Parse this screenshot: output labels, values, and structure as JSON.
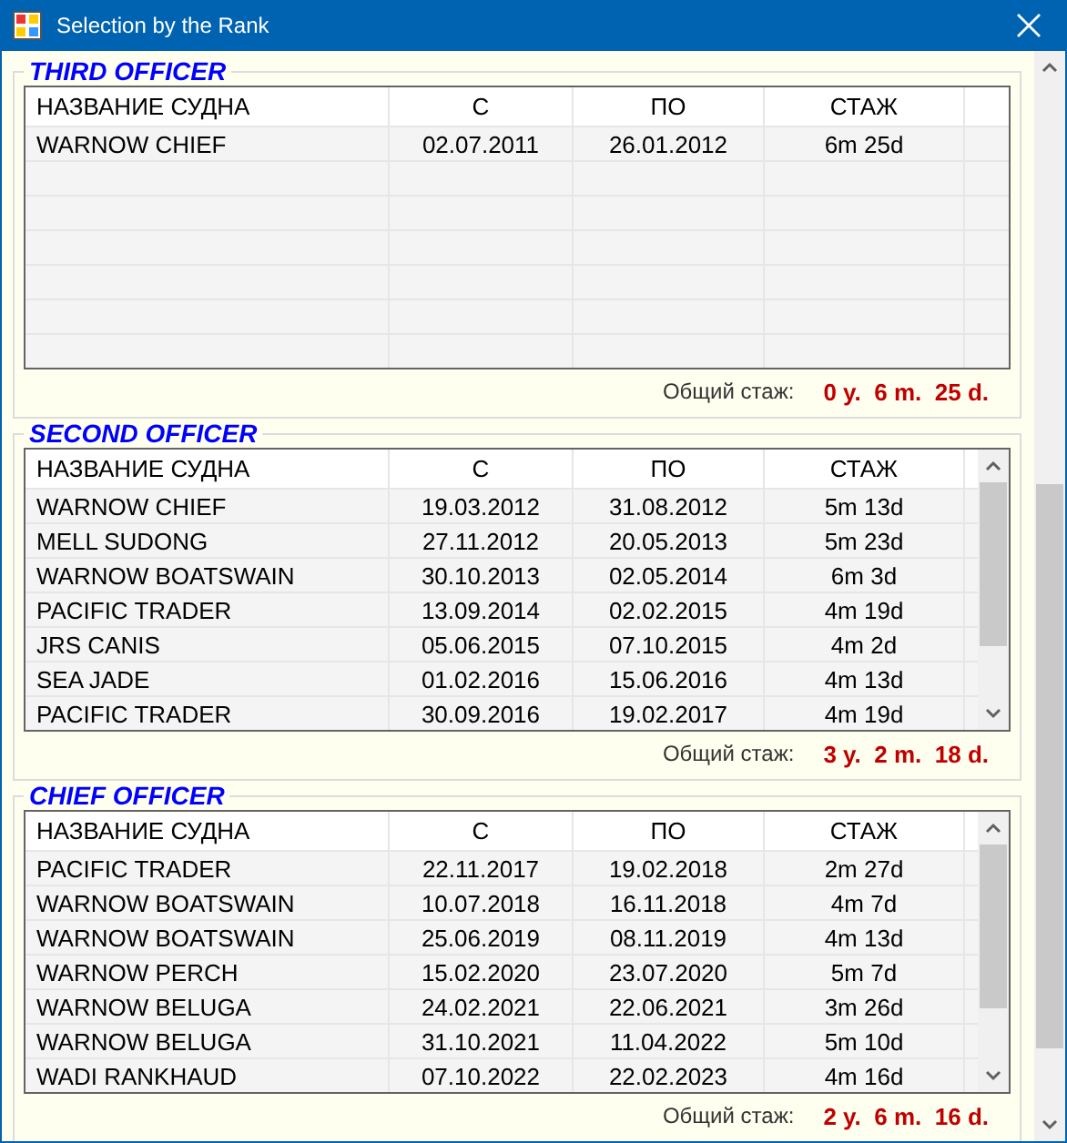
{
  "window": {
    "title": "Selection by the Rank"
  },
  "groups": [
    {
      "title": "THIRD OFFICER",
      "columns": [
        "НАЗВАНИЕ СУДНА",
        "С",
        "ПО",
        "СТАЖ"
      ],
      "rows": [
        [
          "WARNOW CHIEF",
          "02.07.2011",
          "26.01.2012",
          "6m 25d"
        ]
      ],
      "total_label": "Общий стаж:",
      "total": "0 y.  6 m.  25 d."
    },
    {
      "title": "SECOND OFFICER",
      "columns": [
        "НАЗВАНИЕ СУДНА",
        "С",
        "ПО",
        "СТАЖ"
      ],
      "rows": [
        [
          "WARNOW CHIEF",
          "19.03.2012",
          "31.08.2012",
          "5m 13d"
        ],
        [
          "MELL SUDONG",
          "27.11.2012",
          "20.05.2013",
          "5m 23d"
        ],
        [
          "WARNOW BOATSWAIN",
          "30.10.2013",
          "02.05.2014",
          "6m 3d"
        ],
        [
          "PACIFIC TRADER",
          "13.09.2014",
          "02.02.2015",
          "4m 19d"
        ],
        [
          "JRS CANIS",
          "05.06.2015",
          "07.10.2015",
          "4m 2d"
        ],
        [
          "SEA JADE",
          "01.02.2016",
          "15.06.2016",
          "4m 13d"
        ],
        [
          "PACIFIC TRADER",
          "30.09.2016",
          "19.02.2017",
          "4m 19d"
        ]
      ],
      "total_label": "Общий стаж:",
      "total": "3 y.  2 m.  18 d."
    },
    {
      "title": "CHIEF OFFICER",
      "columns": [
        "НАЗВАНИЕ СУДНА",
        "С",
        "ПО",
        "СТАЖ"
      ],
      "rows": [
        [
          "PACIFIC TRADER",
          "22.11.2017",
          "19.02.2018",
          "2m 27d"
        ],
        [
          "WARNOW BOATSWAIN",
          "10.07.2018",
          "16.11.2018",
          "4m 7d"
        ],
        [
          "WARNOW BOATSWAIN",
          "25.06.2019",
          "08.11.2019",
          "4m 13d"
        ],
        [
          "WARNOW PERCH",
          "15.02.2020",
          "23.07.2020",
          "5m 7d"
        ],
        [
          "WARNOW BELUGA",
          "24.02.2021",
          "22.06.2021",
          "3m 26d"
        ],
        [
          "WARNOW BELUGA",
          "31.10.2021",
          "11.04.2022",
          "5m 10d"
        ],
        [
          "WADI RANKHAUD",
          "07.10.2022",
          "22.02.2023",
          "4m 16d"
        ]
      ],
      "total_label": "Общий стаж:",
      "total": "2 y.  6 m.  16 d."
    }
  ]
}
